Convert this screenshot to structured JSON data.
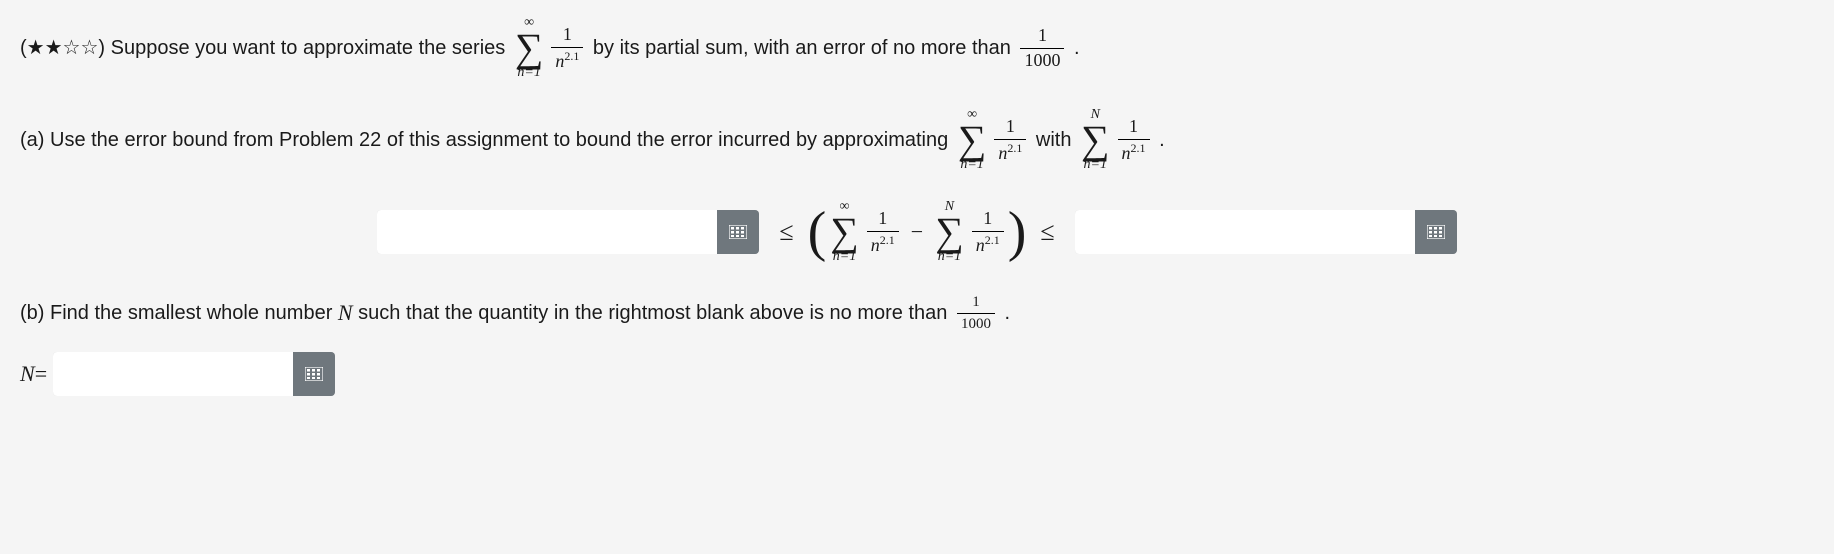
{
  "intro": {
    "stars_filled": "★★",
    "stars_empty": "☆☆",
    "pre": "(",
    "post": ") Suppose you want to approximate the series ",
    "mid": " by its partial sum, with an error of no more than ",
    "end": " ."
  },
  "series": {
    "top_inf": "∞",
    "sigma": "∑",
    "bot": "n=1",
    "frac_num": "1",
    "frac_den_n": "n",
    "frac_den_exp": "2.1"
  },
  "err_frac": {
    "num": "1",
    "den": "1000"
  },
  "part_a": {
    "label": "(a) Use the error bound from Problem 22 of this assignment to bound the error incurred by approximating ",
    "with": " with ",
    "end": " .",
    "top_N": "N"
  },
  "ineq": {
    "le": "≤",
    "minus": "−",
    "lparen": "(",
    "rparen": ")"
  },
  "part_b": {
    "text1": "(b) Find the smallest whole number ",
    "Nvar": "N",
    "text2": " such that the quantity in the rightmost blank above is no more than ",
    "end": " ."
  },
  "answer_prefix": {
    "N": "N",
    "eq": " = "
  },
  "inputs": {
    "left_value": "",
    "right_value": "",
    "N_value": ""
  },
  "icons": {
    "keypad": "keypad-icon"
  }
}
